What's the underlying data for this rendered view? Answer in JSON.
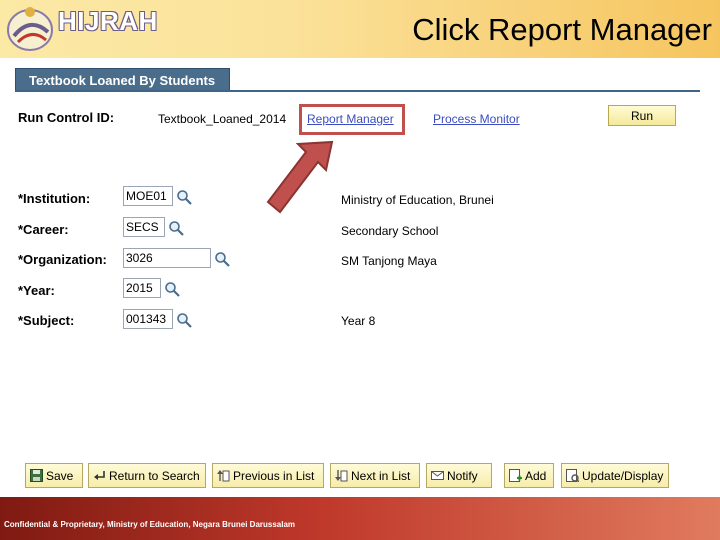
{
  "header": {
    "logo_text": "HIJRAH",
    "slide_title": "Click Report Manager"
  },
  "tab": {
    "label": "Textbook Loaned By Students"
  },
  "run_control": {
    "label": "Run Control ID:",
    "value": "Textbook_Loaned_2014",
    "report_manager": "Report Manager",
    "process_monitor": "Process Monitor",
    "run_label": "Run"
  },
  "fields": {
    "institution": {
      "label": "*Institution:",
      "value": "MOE01",
      "description": "Ministry of Education, Brunei"
    },
    "career": {
      "label": "*Career:",
      "value": "SECS",
      "description": "Secondary School"
    },
    "organization": {
      "label": "*Organization:",
      "value": "3026",
      "description": "SM Tanjong Maya"
    },
    "year": {
      "label": "*Year:",
      "value": "2015"
    },
    "subject": {
      "label": "*Subject:",
      "value": "001343",
      "description": "Year 8"
    }
  },
  "toolbar": {
    "save": "Save",
    "return_to_search": "Return to Search",
    "previous_in_list": "Previous in List",
    "next_in_list": "Next in List",
    "notify": "Notify",
    "add": "Add",
    "update_display": "Update/Display"
  },
  "footer": {
    "text": "Confidential & Proprietary, Ministry of Education, Negara Brunei Darussalam"
  },
  "colors": {
    "highlight": "#c0504d",
    "link": "#3b4cc0",
    "tab": "#4a6d8c",
    "arrow": "#c0504d"
  }
}
